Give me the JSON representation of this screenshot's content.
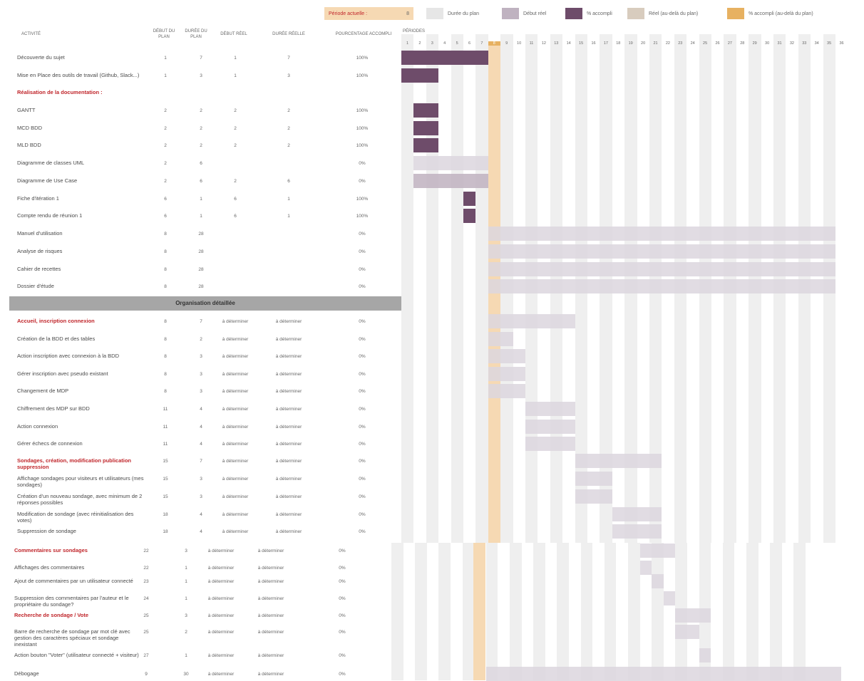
{
  "legend": {
    "period_label": "Période actuelle :",
    "period_value": "8",
    "items": [
      {
        "label": "Durée du plan",
        "color": "#e6e6e6"
      },
      {
        "label": "Début réel",
        "color": "#bfb2c0"
      },
      {
        "label": "% accompli",
        "color": "#6e4c6a"
      },
      {
        "label": "Réel (au-delà du plan)",
        "color": "#d8ccbe"
      },
      {
        "label": "% accompli (au-delà du plan)",
        "color": "#e7b161"
      }
    ]
  },
  "headers": {
    "activity": "ACTIVITÉ",
    "plan_start": "DÉBUT DU PLAN",
    "plan_duration": "DURÉE DU PLAN",
    "real_start": "DÉBUT RÉEL",
    "real_duration": "DURÉE RÉELLE",
    "percent": "POURCENTAGE ACCOMPLI",
    "periods": "PÉRIODES"
  },
  "period_numbers": [
    "1",
    "2",
    "3",
    "4",
    "5",
    "6",
    "7",
    "8",
    "9",
    "10",
    "11",
    "12",
    "13",
    "14",
    "15",
    "16",
    "17",
    "18",
    "19",
    "20",
    "21",
    "22",
    "23",
    "24",
    "25",
    "26",
    "27",
    "28",
    "29",
    "30",
    "31",
    "32",
    "33",
    "34",
    "35",
    "36"
  ],
  "banner": "Organisation détaillée",
  "rows_top": [
    {
      "name": "Découverte du sujet",
      "ps": "1",
      "pd": "7",
      "rs": "1",
      "rd": "7",
      "pct": "100%"
    },
    {
      "name": "Mise en Place des outils de travail (Github, Slack...)",
      "ps": "1",
      "pd": "3",
      "rs": "1",
      "rd": "3",
      "pct": "100%"
    },
    {
      "name": "Réalisation de la documentation :",
      "section": true,
      "ps": "",
      "pd": "",
      "rs": "",
      "rd": "",
      "pct": ""
    },
    {
      "name": "GANTT",
      "ps": "2",
      "pd": "2",
      "rs": "2",
      "rd": "2",
      "pct": "100%"
    },
    {
      "name": "MCD BDD",
      "ps": "2",
      "pd": "2",
      "rs": "2",
      "rd": "2",
      "pct": "100%"
    },
    {
      "name": "MLD BDD",
      "ps": "2",
      "pd": "2",
      "rs": "2",
      "rd": "2",
      "pct": "100%"
    },
    {
      "name": "Diagramme de classes UML",
      "ps": "2",
      "pd": "6",
      "rs": "",
      "rd": "",
      "pct": "0%"
    },
    {
      "name": "Diagramme de Use Case",
      "ps": "2",
      "pd": "6",
      "rs": "2",
      "rd": "6",
      "pct": "0%"
    },
    {
      "name": "Fiche d'itération 1",
      "ps": "6",
      "pd": "1",
      "rs": "6",
      "rd": "1",
      "pct": "100%"
    },
    {
      "name": "Compte rendu de réunion 1",
      "ps": "6",
      "pd": "1",
      "rs": "6",
      "rd": "1",
      "pct": "100%"
    },
    {
      "name": "Manuel d'utilisation",
      "ps": "8",
      "pd": "28",
      "rs": "",
      "rd": "",
      "pct": "0%"
    },
    {
      "name": "Analyse de risques",
      "ps": "8",
      "pd": "28",
      "rs": "",
      "rd": "",
      "pct": "0%"
    },
    {
      "name": "Cahier de recettes",
      "ps": "8",
      "pd": "28",
      "rs": "",
      "rd": "",
      "pct": "0%"
    },
    {
      "name": "Dossier d'étude",
      "ps": "8",
      "pd": "28",
      "rs": "",
      "rd": "",
      "pct": "0%"
    }
  ],
  "rows_mid": [
    {
      "name": "Accueil, inscription connexion",
      "section": true,
      "ps": "8",
      "pd": "7",
      "rs": "à déterminer",
      "rd": "à déterminer",
      "pct": "0%"
    },
    {
      "name": "Création de la BDD et des tables",
      "ps": "8",
      "pd": "2",
      "rs": "à déterminer",
      "rd": "à déterminer",
      "pct": "0%"
    },
    {
      "name": "Action inscription avec connexion à la BDD",
      "ps": "8",
      "pd": "3",
      "rs": "à déterminer",
      "rd": "à déterminer",
      "pct": "0%"
    },
    {
      "name": "Gérer inscription avec pseudo existant",
      "ps": "8",
      "pd": "3",
      "rs": "à déterminer",
      "rd": "à déterminer",
      "pct": "0%"
    },
    {
      "name": "Changement de MDP",
      "ps": "8",
      "pd": "3",
      "rs": "à déterminer",
      "rd": "à déterminer",
      "pct": "0%"
    },
    {
      "name": "Chiffrement des MDP sur BDD",
      "ps": "11",
      "pd": "4",
      "rs": "à déterminer",
      "rd": "à déterminer",
      "pct": "0%"
    },
    {
      "name": "Action connexion",
      "ps": "11",
      "pd": "4",
      "rs": "à déterminer",
      "rd": "à déterminer",
      "pct": "0%"
    },
    {
      "name": "Gérer échecs de connexion",
      "ps": "11",
      "pd": "4",
      "rs": "à déterminer",
      "rd": "à déterminer",
      "pct": "0%"
    },
    {
      "name": "Sondages, création, modification publication suppression",
      "section": true,
      "ps": "15",
      "pd": "7",
      "rs": "à déterminer",
      "rd": "à déterminer",
      "pct": "0%"
    },
    {
      "name": "Affichage sondages pour visiteurs et utilisateurs (mes sondages)",
      "ps": "15",
      "pd": "3",
      "rs": "à déterminer",
      "rd": "à déterminer",
      "pct": "0%"
    },
    {
      "name": "Création d'un nouveau sondage, avec minimum de 2 réponses possibles",
      "ps": "15",
      "pd": "3",
      "rs": "à déterminer",
      "rd": "à déterminer",
      "pct": "0%"
    },
    {
      "name": "Modification de sondage (avec réinitialisation des votes)",
      "ps": "18",
      "pd": "4",
      "rs": "à déterminer",
      "rd": "à déterminer",
      "pct": "0%"
    },
    {
      "name": "Suppression de sondage",
      "ps": "18",
      "pd": "4",
      "rs": "à déterminer",
      "rd": "à déterminer",
      "pct": "0%"
    }
  ],
  "rows_bottom": [
    {
      "name": "Commentaires sur sondages",
      "section": true,
      "ps": "22",
      "pd": "3",
      "rs": "à déterminer",
      "rd": "à déterminer",
      "pct": "0%"
    },
    {
      "name": "Affichages des commentaires",
      "ps": "22",
      "pd": "1",
      "rs": "à déterminer",
      "rd": "à déterminer",
      "pct": "0%"
    },
    {
      "name": "Ajout de commentaires par un utilisateur connecté",
      "ps": "23",
      "pd": "1",
      "rs": "à déterminer",
      "rd": "à déterminer",
      "pct": "0%"
    },
    {
      "name": "Suppression des commentaires par l'auteur et le propriétaire du sondage?",
      "ps": "24",
      "pd": "1",
      "rs": "à déterminer",
      "rd": "à déterminer",
      "pct": "0%"
    },
    {
      "name": "Recherche de sondage / Vote",
      "section": true,
      "ps": "25",
      "pd": "3",
      "rs": "à déterminer",
      "rd": "à déterminer",
      "pct": "0%"
    },
    {
      "name": "Barre de recherche de sondage par mot clé avec gestion des caractères spéciaux et sondage inexistant",
      "ps": "25",
      "pd": "2",
      "rs": "à déterminer",
      "rd": "à déterminer",
      "pct": "0%"
    },
    {
      "name": "Action bouton \"Voter\" (utilisateur connecté + visiteur)",
      "ps": "27",
      "pd": "1",
      "rs": "à déterminer",
      "rd": "à déterminer",
      "pct": "0%"
    },
    {
      "name": "Débogage",
      "ps": "9",
      "pd": "30",
      "rs": "à déterminer",
      "rd": "à déterminer",
      "pct": "0%"
    }
  ]
}
